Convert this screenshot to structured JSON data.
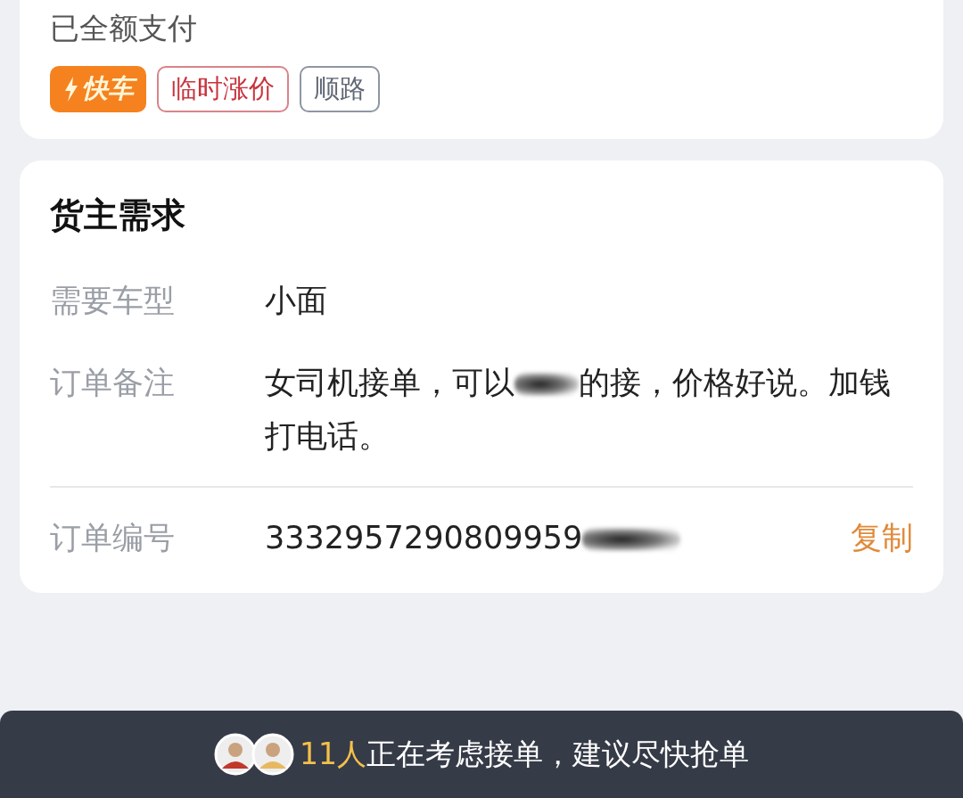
{
  "payment_status": "已全额支付",
  "tags": [
    {
      "kind": "express",
      "label": "快车"
    },
    {
      "kind": "surge",
      "label": "临时涨价"
    },
    {
      "kind": "plain",
      "label": "顺路"
    }
  ],
  "requirements": {
    "title": "货主需求",
    "rows": [
      {
        "kind": "text",
        "label": "需要车型",
        "value": "小面"
      },
      {
        "kind": "redacted",
        "label": "订单备注",
        "before": "女司机接单，可以",
        "after": "的接，价格好说。加钱打电话。"
      },
      {
        "kind": "order",
        "label": "订单编号",
        "value": "3332957290809959",
        "action": "复制"
      }
    ]
  },
  "banner": {
    "count": "11人",
    "text": "正在考虑接单，建议尽快抢单"
  }
}
